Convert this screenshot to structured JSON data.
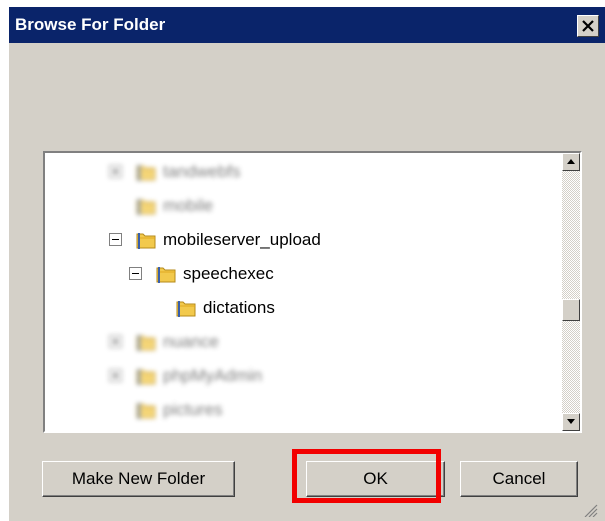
{
  "window": {
    "title": "Browse For Folder"
  },
  "tree": {
    "items": [
      {
        "label": "tandwebfs",
        "depth": 0,
        "expander": "plus",
        "blurred": true
      },
      {
        "label": "mobile",
        "depth": 0,
        "expander": "none",
        "blurred": true
      },
      {
        "label": "mobileserver_upload",
        "depth": 0,
        "expander": "minus",
        "blurred": false
      },
      {
        "label": "speechexec",
        "depth": 1,
        "expander": "minus",
        "blurred": false
      },
      {
        "label": "dictations",
        "depth": 2,
        "expander": "none",
        "blurred": false
      },
      {
        "label": "nuance",
        "depth": 0,
        "expander": "plus",
        "blurred": true
      },
      {
        "label": "phpMyAdmin",
        "depth": 0,
        "expander": "plus",
        "blurred": true
      },
      {
        "label": "pictures",
        "depth": 0,
        "expander": "none",
        "blurred": true
      }
    ]
  },
  "buttons": {
    "make_new_folder": "Make New Folder",
    "ok": "OK",
    "cancel": "Cancel"
  },
  "colors": {
    "titlebar": "#0a246a",
    "face": "#d4d0c8",
    "highlight": "#f20000",
    "folder": "#f2c94c"
  }
}
